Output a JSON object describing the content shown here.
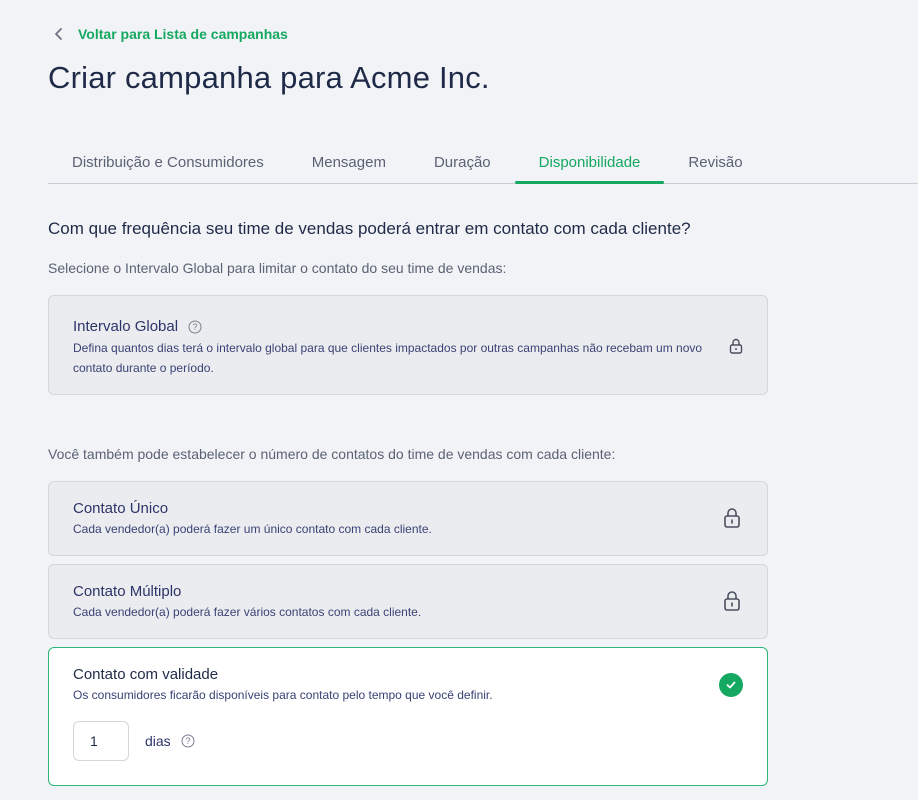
{
  "header": {
    "back_label": "Voltar para Lista de campanhas",
    "title": "Criar campanha para Acme Inc."
  },
  "tabs": [
    {
      "label": "Distribuição e Consumidores",
      "active": false
    },
    {
      "label": "Mensagem",
      "active": false
    },
    {
      "label": "Duração",
      "active": false
    },
    {
      "label": "Disponibilidade",
      "active": true
    },
    {
      "label": "Revisão",
      "active": false
    }
  ],
  "section": {
    "question": "Com que frequência seu time de vendas poderá entrar em contato com cada cliente?",
    "instruction": "Selecione o Intervalo Global para limitar o contato do seu time de vendas:",
    "sub_instruction": "Você também pode estabelecer o número de contatos do time de vendas com cada cliente:"
  },
  "options": {
    "global": {
      "title": "Intervalo Global",
      "description": "Defina quantos dias terá o intervalo global para que clientes impactados por outras campanhas não recebam um novo contato durante o período.",
      "locked": true
    },
    "unique": {
      "title": "Contato Único",
      "description": "Cada vendedor(a) poderá fazer um único contato com cada cliente.",
      "locked": true
    },
    "multiple": {
      "title": "Contato Múltiplo",
      "description": "Cada vendedor(a) poderá fazer vários contatos com cada cliente.",
      "locked": true
    },
    "validity": {
      "title": "Contato com validade",
      "description": "Os consumidores ficarão disponíveis para contato pelo tempo que você definir.",
      "selected": true,
      "days_value": "1",
      "days_label": "dias"
    }
  },
  "colors": {
    "accent": "#15a861",
    "title": "#1e2a47",
    "background": "#f2f3f6"
  }
}
